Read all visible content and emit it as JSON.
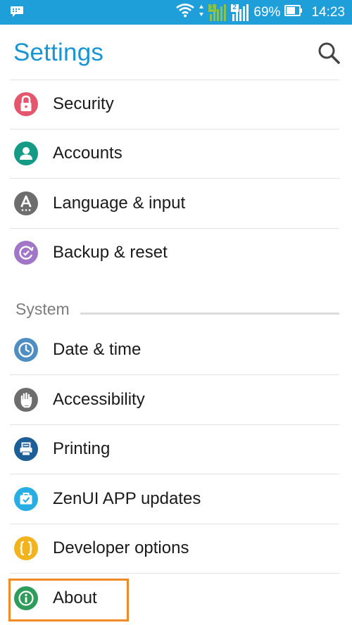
{
  "status_bar": {
    "battery_percent": "69%",
    "time": "14:23",
    "sim1_label": "1",
    "sim2_label": "2",
    "background_color": "#1f9fd9"
  },
  "header": {
    "title": "Settings",
    "search_icon": "search-icon"
  },
  "personal_items": [
    {
      "label": "Security",
      "icon": "lock-icon",
      "color": "#e5566e"
    },
    {
      "label": "Accounts",
      "icon": "person-icon",
      "color": "#159a86"
    },
    {
      "label": "Language & input",
      "icon": "language-icon",
      "color": "#6d6d6d"
    },
    {
      "label": "Backup & reset",
      "icon": "backup-icon",
      "color": "#a176c6"
    }
  ],
  "system_section": {
    "title": "System"
  },
  "system_items": [
    {
      "label": "Date & time",
      "icon": "clock-icon",
      "color": "#4f8ec3"
    },
    {
      "label": "Accessibility",
      "icon": "hand-icon",
      "color": "#6d6d6d"
    },
    {
      "label": "Printing",
      "icon": "printer-icon",
      "color": "#1e5e97"
    },
    {
      "label": "ZenUI APP updates",
      "icon": "briefcase-check-icon",
      "color": "#27aee2"
    },
    {
      "label": "Developer options",
      "icon": "braces-icon",
      "color": "#f2b31f"
    },
    {
      "label": "About",
      "icon": "info-icon",
      "color": "#2f9c5c"
    }
  ],
  "highlight_color": "#f08a24"
}
